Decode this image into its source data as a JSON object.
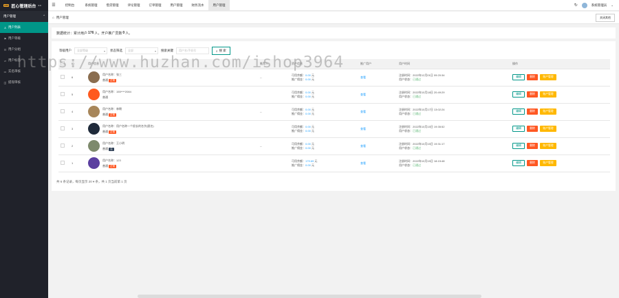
{
  "app": {
    "logo_mark": "crm",
    "title": "匠心管理后台",
    "version": "3.0"
  },
  "sidebar": {
    "group": "用户管理",
    "items": [
      {
        "label": "用户列表",
        "icon": "user-icon",
        "active": true
      },
      {
        "label": "用户等级",
        "icon": "level-icon",
        "active": false
      },
      {
        "label": "用户分组",
        "icon": "group-icon",
        "active": false
      },
      {
        "label": "用户标签",
        "icon": "tag-icon",
        "active": false
      },
      {
        "label": "实名审核",
        "icon": "idcard-icon",
        "active": false
      },
      {
        "label": "提现审核",
        "icon": "wallet-icon",
        "active": false
      }
    ]
  },
  "topnav": [
    "控制台",
    "系统管理",
    "借贷管理",
    "评论管理",
    "订单管理",
    "用户管理",
    "财务流水",
    "用户管理"
  ],
  "topnav_active_index": 7,
  "top_right": {
    "user": "系统管理员"
  },
  "tabstrip": {
    "current": "用户管理",
    "close_other": "关闭其他"
  },
  "stats": {
    "prefix": "数据统计：",
    "text1": "累计用户",
    "count": "176",
    "unit1": "人，",
    "text2": "开户推广员数",
    "promoters": "0",
    "unit2": "人。"
  },
  "filters": {
    "level_label": "等级用户",
    "level_placeholder": "全部等级",
    "status_label": "状态筛选",
    "status_placeholder": "全部",
    "keyword_label": "搜索关键",
    "keyword_placeholder": "用户名/手机号",
    "search_button": "搜 索"
  },
  "table": {
    "headers": [
      "",
      "ID",
      "用户信息",
      "推荐人",
      "资产信息",
      "推广用户",
      "用户时间",
      "操作"
    ],
    "rows": [
      {
        "id": "6",
        "line1": "用户名称：张三",
        "level": "普通",
        "tag": "正常",
        "tag_color": "#ff5722",
        "avatar": "#8a6d4f",
        "ref": "--",
        "balance": "0.00",
        "income": "0.00",
        "reg": "2022年12月01日 09:20:34",
        "status": "已通过"
      },
      {
        "id": "5",
        "line1": "用户名称：155****2084",
        "level": "普通",
        "tag": "",
        "tag_color": "",
        "avatar": "#ff5a1f",
        "ref": "",
        "balance": "0.00",
        "income": "0.00",
        "reg": "2022年10月18日 20:49:29",
        "status": "已通过"
      },
      {
        "id": "4",
        "line1": "用户名称：林朝",
        "level": "普通",
        "tag": "正常",
        "tag_color": "#ff5722",
        "avatar": "#a7865a",
        "ref": "--",
        "balance": "0.00",
        "income": "0.00",
        "reg": "2022年10月17日 13:02:24",
        "status": "已通过"
      },
      {
        "id": "3",
        "line1": "用户名称：用户名称一个很长的名字(匿名)",
        "level": "普通",
        "tag": "正常",
        "tag_color": "#ff5722",
        "avatar": "#1f2a3a",
        "ref": "",
        "balance": "0.00",
        "income": "0.00",
        "reg": "2022年10月15日 19:35:52",
        "status": "已通过"
      },
      {
        "id": "2",
        "line1": "用户名称：王小明",
        "level": "普通",
        "tag": "注",
        "tag_color": "#2f4056",
        "avatar": "#7d8a6c",
        "ref": "--",
        "balance": "0.00",
        "income": "0.00",
        "reg": "2022年10月15日 19:31:17",
        "status": "已通过"
      },
      {
        "id": "1",
        "line1": "用户名称：123",
        "level": "普通",
        "tag": "正常",
        "tag_color": "#ff5722",
        "avatar": "#5b3fa0",
        "ref": "",
        "balance": "179.69",
        "income": "0.00",
        "reg": "2022年10月15日 18:15:48",
        "status": "已通过"
      }
    ],
    "balance_label": "可用余额：",
    "income_label": "推广佣金：",
    "money_unit": "元",
    "reg_label": "注册时间：",
    "status_label": "用户状态：",
    "open_label": "查看",
    "edit_label": "编辑",
    "delete_label": "删除",
    "account_label": "账户管理"
  },
  "pager": "共 6 条记录，每页显示 20 ▾ 条，共 1 页当前第 1 页",
  "watermark": "https://www.huzhan.com/ishop3964"
}
